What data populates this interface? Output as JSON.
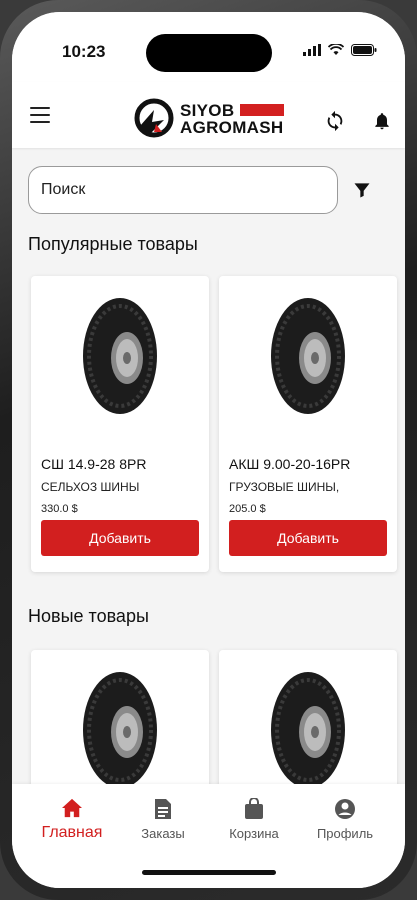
{
  "status": {
    "time": "10:23"
  },
  "header": {
    "logo_line1": "SIYOB",
    "logo_line2": "AGROMASH",
    "icons": [
      "menu-icon",
      "sync-icon",
      "bell-icon"
    ]
  },
  "search": {
    "placeholder": "Поиск",
    "value": ""
  },
  "popular": {
    "title": "Популярные товары",
    "products": [
      {
        "name": "СШ 14.9-28 8PR",
        "category": "СЕЛЬХОЗ ШИНЫ",
        "price": "330.0 $",
        "button": "Добавить"
      },
      {
        "name": "АКШ 9.00-20-16PR",
        "category": "ГРУЗОВЫЕ ШИНЫ,",
        "price": "205.0 $",
        "button": "Добавить"
      }
    ]
  },
  "new": {
    "title": "Новые товары"
  },
  "nav": {
    "items": [
      {
        "label": "Главная",
        "icon": "home-icon",
        "active": true
      },
      {
        "label": "Заказы",
        "icon": "orders-icon",
        "active": false
      },
      {
        "label": "Корзина",
        "icon": "cart-icon",
        "active": false
      },
      {
        "label": "Профиль",
        "icon": "profile-icon",
        "active": false
      }
    ]
  },
  "colors": {
    "accent": "#d21f1f",
    "background": "#f4f4f4"
  }
}
